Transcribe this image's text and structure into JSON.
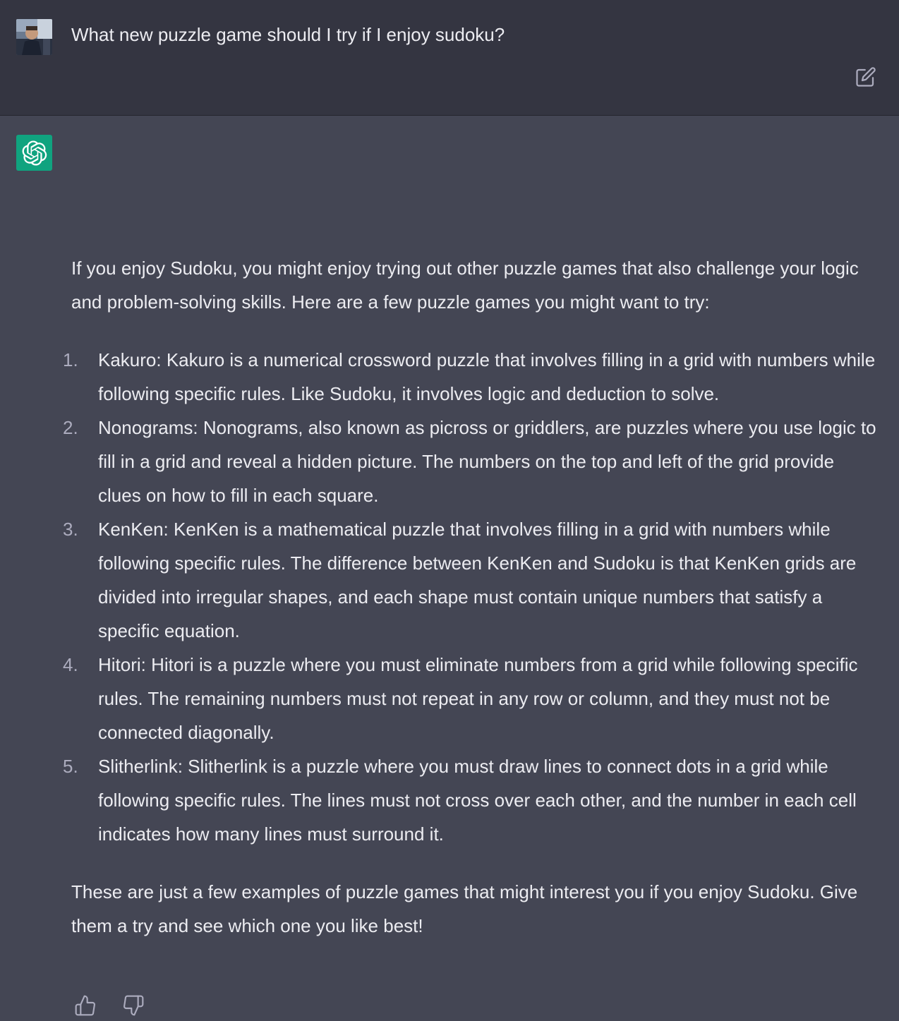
{
  "conversation": {
    "user": {
      "avatar_icon": "user-photo-avatar",
      "message": "What new puzzle game should I try if I enjoy sudoku?",
      "edit_icon": "edit-icon"
    },
    "assistant": {
      "avatar_icon": "openai-logo-icon",
      "intro": "If you enjoy Sudoku, you might enjoy trying out other puzzle games that also challenge your logic and problem-solving skills. Here are a few puzzle games you might want to try:",
      "items": [
        {
          "number": "1.",
          "text": "Kakuro: Kakuro is a numerical crossword puzzle that involves filling in a grid with numbers while following specific rules. Like Sudoku, it involves logic and deduction to solve."
        },
        {
          "number": "2.",
          "text": "Nonograms: Nonograms, also known as picross or griddlers, are puzzles where you use logic to fill in a grid and reveal a hidden picture. The numbers on the top and left of the grid provide clues on how to fill in each square."
        },
        {
          "number": "3.",
          "text": "KenKen: KenKen is a mathematical puzzle that involves filling in a grid with numbers while following specific rules. The difference between KenKen and Sudoku is that KenKen grids are divided into irregular shapes, and each shape must contain unique numbers that satisfy a specific equation."
        },
        {
          "number": "4.",
          "text": "Hitori: Hitori is a puzzle where you must eliminate numbers from a grid while following specific rules. The remaining numbers must not repeat in any row or column, and they must not be connected diagonally."
        },
        {
          "number": "5.",
          "text": "Slitherlink: Slitherlink is a puzzle where you must draw lines to connect dots in a grid while following specific rules. The lines must not cross over each other, and the number in each cell indicates how many lines must surround it."
        }
      ],
      "outro": "These are just a few examples of puzzle games that might interest you if you enjoy Sudoku. Give them a try and see which one you like best!",
      "feedback": {
        "thumbs_up_icon": "thumbs-up-icon",
        "thumbs_down_icon": "thumbs-down-icon"
      }
    }
  },
  "colors": {
    "user_bg": "#343541",
    "assistant_bg": "#444654",
    "text": "#ececf1",
    "list_number": "#acacbe",
    "brand_green": "#10a37f"
  }
}
